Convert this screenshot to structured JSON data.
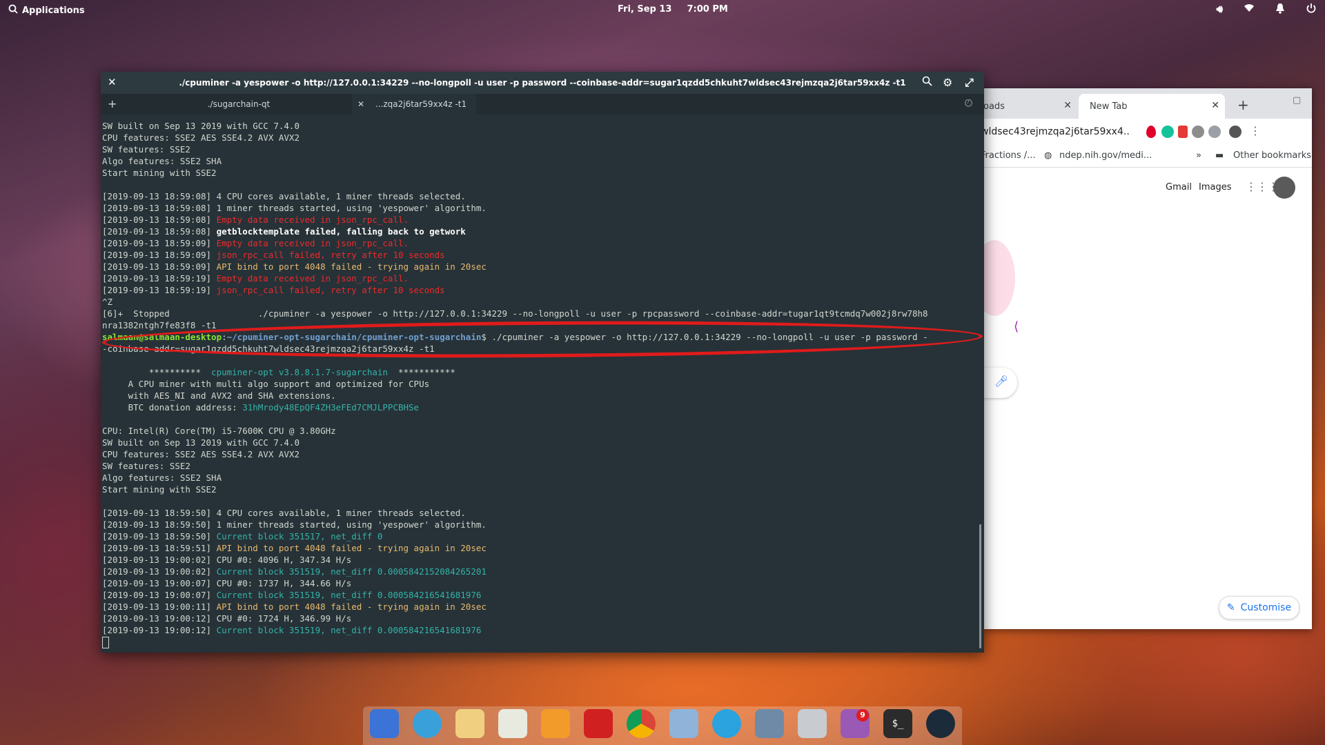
{
  "topbar": {
    "applications": "Applications",
    "date": "Fri, Sep 13",
    "time": "7:00 PM",
    "icons": [
      "volume-icon",
      "wifi-icon",
      "bell-icon",
      "power-icon"
    ]
  },
  "browser": {
    "tabs": [
      {
        "label": "oads"
      },
      {
        "label": "New Tab"
      }
    ],
    "omnibox": "wldsec43rejmzqa2j6tar59xx4...",
    "bookmarks": [
      "Fractions /...",
      "ndep.nih.gov/medi...",
      "»",
      "Other bookmarks"
    ],
    "gmail": "Gmail",
    "images": "Images",
    "customise": "Customise"
  },
  "terminal": {
    "title": "./cpuminer -a yespower -o http://127.0.0.1:34229 --no-longpoll -u user -p password --coinbase-addr=sugar1qzdd5chkuht7wldsec43rejmzqa2j6tar59xx4z -t1",
    "tabs": [
      "./sugarchain-qt",
      "...zqa2j6tar59xx4z -t1"
    ],
    "lines": [
      [
        {
          "t": "SW built on Sep 13 2019 with GCC 7.4.0",
          "c": ""
        }
      ],
      [
        {
          "t": "CPU features: SSE2 AES SSE4.2 AVX AVX2",
          "c": ""
        }
      ],
      [
        {
          "t": "SW features: SSE2",
          "c": ""
        }
      ],
      [
        {
          "t": "Algo features: SSE2 SHA",
          "c": ""
        }
      ],
      [
        {
          "t": "Start mining with SSE2",
          "c": ""
        }
      ],
      [
        {
          "t": "",
          "c": ""
        }
      ],
      [
        {
          "t": "[2019-09-13 18:59:08] 4 CPU cores available, 1 miner threads selected.",
          "c": ""
        }
      ],
      [
        {
          "t": "[2019-09-13 18:59:08] 1 miner threads started, using 'yespower' algorithm.",
          "c": ""
        }
      ],
      [
        {
          "t": "[2019-09-13 18:59:08] ",
          "c": ""
        },
        {
          "t": "Empty data received in json_rpc_call.",
          "c": "r"
        }
      ],
      [
        {
          "t": "[2019-09-13 18:59:08] ",
          "c": ""
        },
        {
          "t": "getblocktemplate failed, falling back to getwork",
          "c": "b"
        }
      ],
      [
        {
          "t": "[2019-09-13 18:59:09] ",
          "c": ""
        },
        {
          "t": "Empty data received in json_rpc_call.",
          "c": "r"
        }
      ],
      [
        {
          "t": "[2019-09-13 18:59:09] ",
          "c": ""
        },
        {
          "t": "json_rpc_call failed, retry after 10 seconds",
          "c": "r"
        }
      ],
      [
        {
          "t": "[2019-09-13 18:59:09] ",
          "c": ""
        },
        {
          "t": "API bind to port 4048 failed - trying again in 20sec",
          "c": "y"
        }
      ],
      [
        {
          "t": "[2019-09-13 18:59:19] ",
          "c": ""
        },
        {
          "t": "Empty data received in json_rpc_call.",
          "c": "r"
        }
      ],
      [
        {
          "t": "[2019-09-13 18:59:19] ",
          "c": ""
        },
        {
          "t": "json_rpc_call failed, retry after 10 seconds",
          "c": "r"
        }
      ],
      [
        {
          "t": "^Z",
          "c": ""
        }
      ],
      [
        {
          "t": "[6]+  Stopped                 ./cpuminer -a yespower -o http://127.0.0.1:34229 --no-longpoll -u user -p rpcpassword --coinbase-addr=tugar1qt9tcmdq7w002j8rw78h8",
          "c": ""
        }
      ],
      [
        {
          "t": "nra1382ntgh7fe83f8 -t1",
          "c": ""
        }
      ],
      [
        {
          "t": "salmaan@salmaan-desktop",
          "c": "pg"
        },
        {
          "t": ":",
          "c": ""
        },
        {
          "t": "~/cpuminer-opt-sugarchain/cpuminer-opt-sugarchain",
          "c": "pb"
        },
        {
          "t": "$ ./cpuminer -a yespower -o http://127.0.0.1:34229 --no-longpoll -u user -p password -",
          "c": ""
        }
      ],
      [
        {
          "t": "-coinbase-addr=sugar1qzdd5chkuht7wldsec43rejmzqa2j6tar59xx4z -t1",
          "c": ""
        }
      ],
      [
        {
          "t": "",
          "c": ""
        }
      ],
      [
        {
          "t": "         **********  ",
          "c": ""
        },
        {
          "t": "cpuminer-opt v3.8.8.1.7-sugarchain",
          "c": "c"
        },
        {
          "t": "  ***********",
          "c": ""
        }
      ],
      [
        {
          "t": "     A CPU miner with multi algo support and optimized for CPUs",
          "c": ""
        }
      ],
      [
        {
          "t": "     with AES_NI and AVX2 and SHA extensions.",
          "c": ""
        }
      ],
      [
        {
          "t": "     BTC donation address: ",
          "c": ""
        },
        {
          "t": "31hMrody48EpQF4ZH3eFEd7CMJLPPCBHSe",
          "c": "c"
        }
      ],
      [
        {
          "t": "",
          "c": ""
        }
      ],
      [
        {
          "t": "CPU: Intel(R) Core(TM) i5-7600K CPU @ 3.80GHz",
          "c": ""
        }
      ],
      [
        {
          "t": "SW built on Sep 13 2019 with GCC 7.4.0",
          "c": ""
        }
      ],
      [
        {
          "t": "CPU features: SSE2 AES SSE4.2 AVX AVX2",
          "c": ""
        }
      ],
      [
        {
          "t": "SW features: SSE2",
          "c": ""
        }
      ],
      [
        {
          "t": "Algo features: SSE2 SHA",
          "c": ""
        }
      ],
      [
        {
          "t": "Start mining with SSE2",
          "c": ""
        }
      ],
      [
        {
          "t": "",
          "c": ""
        }
      ],
      [
        {
          "t": "[2019-09-13 18:59:50] 4 CPU cores available, 1 miner threads selected.",
          "c": ""
        }
      ],
      [
        {
          "t": "[2019-09-13 18:59:50] 1 miner threads started, using 'yespower' algorithm.",
          "c": ""
        }
      ],
      [
        {
          "t": "[2019-09-13 18:59:50] ",
          "c": ""
        },
        {
          "t": "Current block 351517, net_diff 0",
          "c": "c"
        }
      ],
      [
        {
          "t": "[2019-09-13 18:59:51] ",
          "c": ""
        },
        {
          "t": "API bind to port 4048 failed - trying again in 20sec",
          "c": "y"
        }
      ],
      [
        {
          "t": "[2019-09-13 19:00:02] CPU #0: 4096 H, 347.34 H/s",
          "c": ""
        }
      ],
      [
        {
          "t": "[2019-09-13 19:00:02] ",
          "c": ""
        },
        {
          "t": "Current block 351519, net_diff 0.0005842152084265201",
          "c": "c"
        }
      ],
      [
        {
          "t": "[2019-09-13 19:00:07] CPU #0: 1737 H, 344.66 H/s",
          "c": ""
        }
      ],
      [
        {
          "t": "[2019-09-13 19:00:07] ",
          "c": ""
        },
        {
          "t": "Current block 351519, net_diff 0.000584216541681976",
          "c": "c"
        }
      ],
      [
        {
          "t": "[2019-09-13 19:00:11] ",
          "c": ""
        },
        {
          "t": "API bind to port 4048 failed - trying again in 20sec",
          "c": "y"
        }
      ],
      [
        {
          "t": "[2019-09-13 19:00:12] CPU #0: 1724 H, 346.99 H/s",
          "c": ""
        }
      ],
      [
        {
          "t": "[2019-09-13 19:00:12] ",
          "c": ""
        },
        {
          "t": "Current block 351519, net_diff 0.000584216541681976",
          "c": "c"
        }
      ]
    ]
  },
  "dock": {
    "apps": [
      "multitasking-view",
      "web-browser-epiphany",
      "mail",
      "calendar",
      "music",
      "videos",
      "chrome",
      "photos",
      "telegram",
      "switchboard-settings",
      "files",
      "app-center",
      "terminal",
      "ubuntu-software"
    ],
    "app_center_badge": "9"
  }
}
